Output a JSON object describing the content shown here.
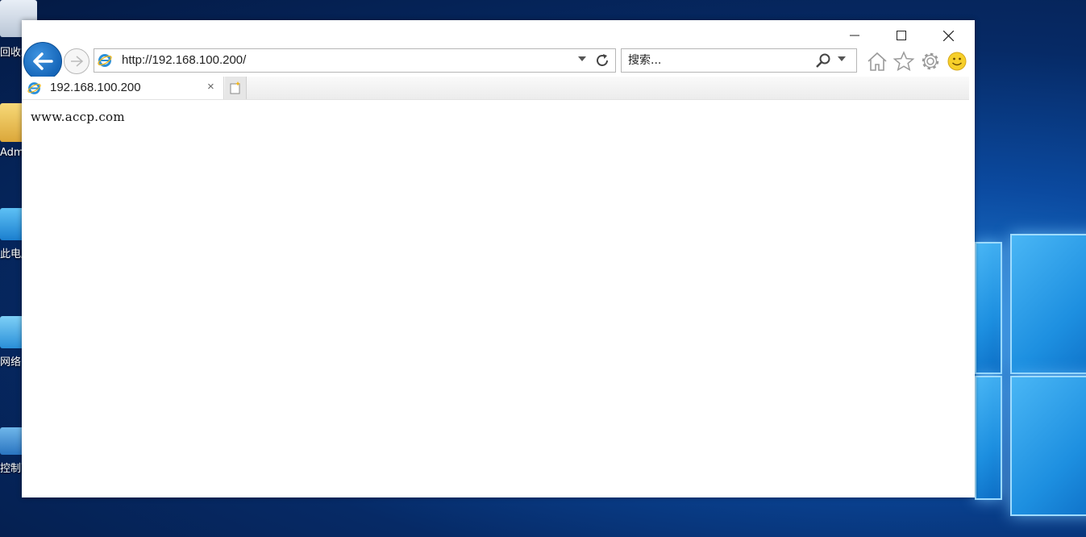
{
  "desktop": {
    "icons": [
      {
        "label": "回收站",
        "icon": "recycle-bin-icon"
      },
      {
        "label": "Administrator",
        "icon": "user-folder-icon"
      },
      {
        "label": "此电脑",
        "icon": "computer-icon"
      },
      {
        "label": "网络",
        "icon": "network-icon"
      },
      {
        "label": "控制面板",
        "icon": "control-panel-icon"
      }
    ]
  },
  "browser": {
    "address": {
      "url": "http://192.168.100.200/"
    },
    "search": {
      "placeholder": "搜索..."
    },
    "tabs": [
      {
        "title": "192.168.100.200",
        "close": "×"
      }
    ],
    "page": {
      "text": "www.accp.com"
    }
  },
  "colors": {
    "accent": "#1565b8",
    "desktop_bg": "#062a66"
  }
}
